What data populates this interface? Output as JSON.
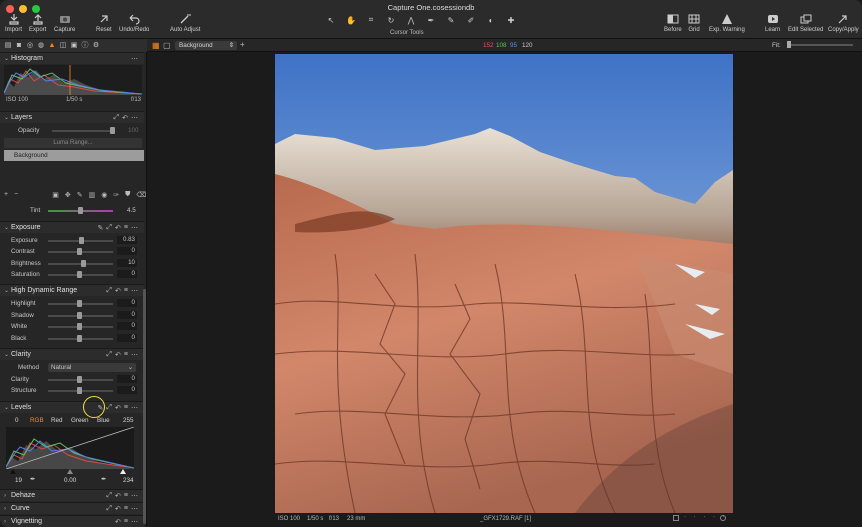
{
  "window": {
    "title": "Capture One.cosessiondb"
  },
  "toolbar": {
    "left": [
      {
        "label": "Import"
      },
      {
        "label": "Export"
      },
      {
        "label": "Capture"
      },
      {
        "label": "Reset"
      },
      {
        "label": "Undo/Redo"
      },
      {
        "label": "Auto Adjust"
      }
    ],
    "tools_label": "Cursor Tools",
    "right": [
      {
        "label": "Before"
      },
      {
        "label": "Grid"
      },
      {
        "label": "Exp. Warning"
      },
      {
        "label": "Learn"
      },
      {
        "label": "Edit Selected"
      },
      {
        "label": "Copy/Apply"
      }
    ]
  },
  "viewer": {
    "layer_select": "Background",
    "rgb_readout": {
      "r": "152",
      "g": "108",
      "b": "95",
      "a": "120"
    },
    "fit_label": "Fit:"
  },
  "histogram": {
    "title": "Histogram",
    "iso": "ISO 100",
    "shutter": "1/50 s",
    "aperture": "f/13"
  },
  "layers": {
    "title": "Layers",
    "opacity_label": "Opacity",
    "opacity_value": "100",
    "luma_range": "Luma Range...",
    "background": "Background"
  },
  "tint": {
    "label": "Tint",
    "value": "4.5"
  },
  "exposure": {
    "title": "Exposure",
    "rows": [
      {
        "label": "Exposure",
        "value": "0.83"
      },
      {
        "label": "Contrast",
        "value": "0"
      },
      {
        "label": "Brightness",
        "value": "10"
      },
      {
        "label": "Saturation",
        "value": "0"
      }
    ]
  },
  "hdr": {
    "title": "High Dynamic Range",
    "rows": [
      {
        "label": "Highlight",
        "value": "0"
      },
      {
        "label": "Shadow",
        "value": "0"
      },
      {
        "label": "White",
        "value": "0"
      },
      {
        "label": "Black",
        "value": "0"
      }
    ]
  },
  "clarity": {
    "title": "Clarity",
    "method_label": "Method",
    "method_value": "Natural",
    "rows": [
      {
        "label": "Clarity",
        "value": "0"
      },
      {
        "label": "Structure",
        "value": "0"
      }
    ]
  },
  "levels": {
    "title": "Levels",
    "channels": [
      "RGB",
      "Red",
      "Green",
      "Blue"
    ],
    "in_low": "0",
    "in_high": "255",
    "out_low": "19",
    "mid": "0.00",
    "out_high": "234"
  },
  "collapsed": [
    {
      "title": "Dehaze"
    },
    {
      "title": "Curve"
    },
    {
      "title": "Vignetting"
    }
  ],
  "status": {
    "iso": "ISO 100",
    "shutter": "1/50 s",
    "aperture": "f/13",
    "focal": "23 mm",
    "file": "_GFX1729.RAF [1]"
  },
  "colors": {
    "accent": "#ff8a1a",
    "highlight": "#f2e33b"
  }
}
